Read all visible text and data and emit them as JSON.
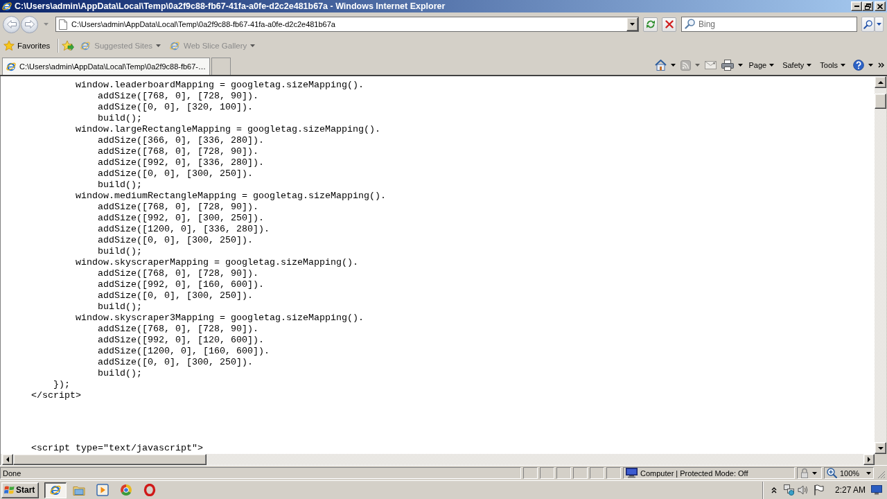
{
  "window": {
    "title": "C:\\Users\\admin\\AppData\\Local\\Temp\\0a2f9c88-fb67-41fa-a0fe-d2c2e481b67a - Windows Internet Explorer"
  },
  "navigation": {
    "back": {
      "disabled": true
    },
    "forward": {
      "disabled": true
    },
    "address": {
      "value": "C:\\Users\\admin\\AppData\\Local\\Temp\\0a2f9c88-fb67-41fa-a0fe-d2c2e481b67a"
    },
    "search": {
      "placeholder": "Bing"
    }
  },
  "favorites_bar": {
    "label": "Favorites",
    "items": [
      {
        "label": "Suggested Sites",
        "disabled": true
      },
      {
        "label": "Web Slice Gallery",
        "disabled": true
      }
    ]
  },
  "tabs": [
    {
      "label": "C:\\Users\\admin\\AppData\\Local\\Temp\\0a2f9c88-fb67-…",
      "selected": true
    }
  ],
  "command_bar": {
    "tools": [
      {
        "kind": "home",
        "disabled": false
      },
      {
        "kind": "feeds",
        "disabled": true
      },
      {
        "kind": "mail",
        "disabled": true
      },
      {
        "kind": "print",
        "disabled": false
      }
    ],
    "menus": [
      {
        "label": "Page"
      },
      {
        "label": "Safety"
      },
      {
        "label": "Tools"
      }
    ]
  },
  "source_view": {
    "lines": [
      "            window.leaderboardMapping = googletag.sizeMapping().",
      "                addSize([768, 0], [728, 90]).",
      "                addSize([0, 0], [320, 100]).",
      "                build();",
      "            window.largeRectangleMapping = googletag.sizeMapping().",
      "                addSize([366, 0], [336, 280]).",
      "                addSize([768, 0], [728, 90]).",
      "                addSize([992, 0], [336, 280]).",
      "                addSize([0, 0], [300, 250]).",
      "                build();",
      "            window.mediumRectangleMapping = googletag.sizeMapping().",
      "                addSize([768, 0], [728, 90]).",
      "                addSize([992, 0], [300, 250]).",
      "                addSize([1200, 0], [336, 280]).",
      "                addSize([0, 0], [300, 250]).",
      "                build();",
      "            window.skyscraperMapping = googletag.sizeMapping().",
      "                addSize([768, 0], [728, 90]).",
      "                addSize([992, 0], [160, 600]).",
      "                addSize([0, 0], [300, 250]).",
      "                build();",
      "            window.skyscraper3Mapping = googletag.sizeMapping().",
      "                addSize([768, 0], [728, 90]).",
      "                addSize([992, 0], [120, 600]).",
      "                addSize([1200, 0], [160, 600]).",
      "                addSize([0, 0], [300, 250]).",
      "                build();",
      "        });",
      "    </script>"
    ],
    "next_block": [
      "    <script type=\"text/javascript\">"
    ]
  },
  "status_bar": {
    "text": "Done",
    "zone": "Computer | Protected Mode: Off",
    "zoom": "100%"
  },
  "taskbar": {
    "start": "Start",
    "apps": [
      {
        "kind": "browser",
        "selected": true
      },
      {
        "kind": "folder",
        "selected": false
      },
      {
        "kind": "media",
        "selected": false
      },
      {
        "kind": "circle",
        "selected": false
      },
      {
        "kind": "ring",
        "selected": false
      }
    ],
    "clock": "2:27 AM"
  }
}
